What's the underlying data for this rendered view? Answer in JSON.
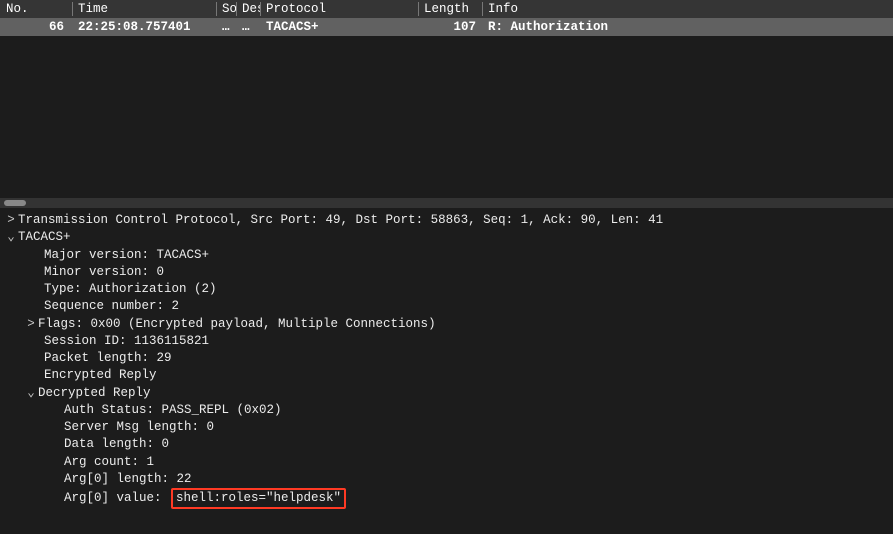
{
  "columns": {
    "no": "No.",
    "time": "Time",
    "src": "Source",
    "dst": "Destination",
    "proto": "Protocol",
    "len": "Length",
    "info": "Info"
  },
  "row": {
    "no": "66",
    "time": "22:25:08.757401",
    "src": "…",
    "dst": "…",
    "proto": "TACACS+",
    "len": "107",
    "info": "R: Authorization"
  },
  "detail": {
    "tcp": "Transmission Control Protocol, Src Port: 49, Dst Port: 58863, Seq: 1, Ack: 90, Len: 41",
    "tacacs": {
      "label": "TACACS+",
      "major": "Major version: TACACS+",
      "minor": "Minor version: 0",
      "type": "Type: Authorization (2)",
      "seq": "Sequence number: 2",
      "flags": "Flags: 0x00 (Encrypted payload, Multiple Connections)",
      "session": "Session ID: 1136115821",
      "plen": "Packet length: 29",
      "enc": "Encrypted Reply",
      "dec": {
        "label": "Decrypted Reply",
        "auth": "Auth Status: PASS_REPL (0x02)",
        "smsg": "Server Msg length: 0",
        "dlen": "Data length: 0",
        "argc": "Arg count: 1",
        "arg0len": "Arg[0] length: 22",
        "arg0val_label": "Arg[0] value: ",
        "arg0val": "shell:roles=\"helpdesk\""
      }
    }
  },
  "twisty": {
    "closed": ">",
    "open": "⌄"
  }
}
